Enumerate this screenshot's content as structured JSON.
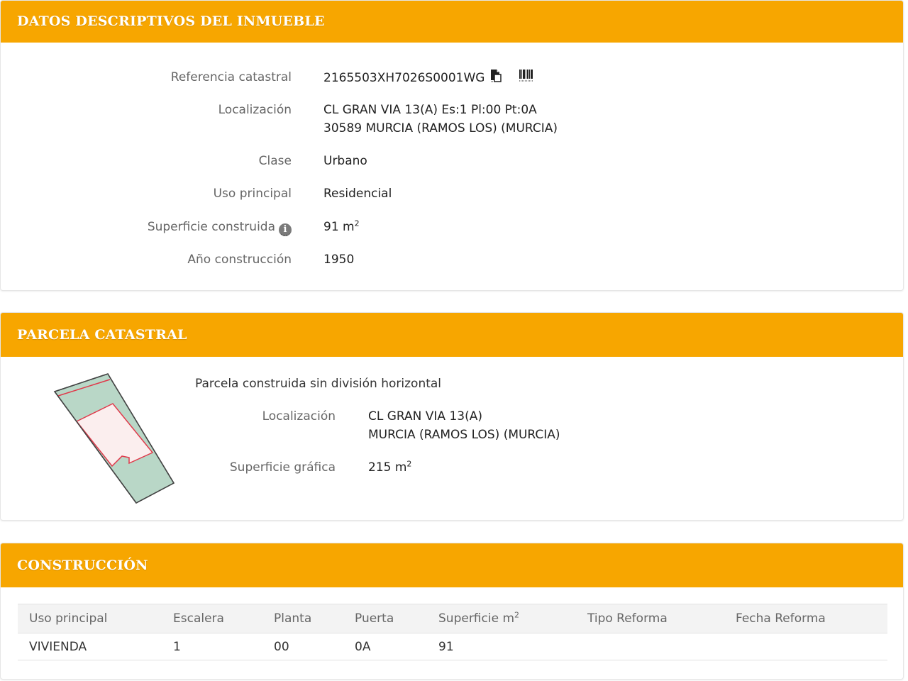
{
  "datos": {
    "title": "DATOS DESCRIPTIVOS DEL INMUEBLE",
    "referencia_label": "Referencia catastral",
    "referencia_value": "2165503XH7026S0001WG",
    "localizacion_label": "Localización",
    "localizacion_line1": "CL GRAN VIA 13(A) Es:1 Pl:00 Pt:0A",
    "localizacion_line2": "30589 MURCIA (RAMOS LOS) (MURCIA)",
    "clase_label": "Clase",
    "clase_value": "Urbano",
    "uso_label": "Uso principal",
    "uso_value": "Residencial",
    "superficie_label": "Superficie construida",
    "superficie_value": "91 m",
    "superficie_exp": "2",
    "anio_label": "Año construcción",
    "anio_value": "1950"
  },
  "parcela": {
    "title": "PARCELA CATASTRAL",
    "subtitle": "Parcela construida sin división horizontal",
    "localizacion_label": "Localización",
    "localizacion_line1": "CL GRAN VIA 13(A)",
    "localizacion_line2": "MURCIA (RAMOS LOS) (MURCIA)",
    "superficie_label": "Superficie gráfica",
    "superficie_value": "215 m",
    "superficie_exp": "2"
  },
  "construccion": {
    "title": "CONSTRUCCIÓN",
    "headers": [
      "Uso principal",
      "Escalera",
      "Planta",
      "Puerta",
      "Superficie m",
      "Tipo Reforma",
      "Fecha Reforma"
    ],
    "superficie_exp": "2",
    "rows": [
      [
        "VIVIENDA",
        "1",
        "00",
        "0A",
        "91",
        "",
        ""
      ]
    ]
  },
  "colors": {
    "header_orange": "#f7a600",
    "parcel_green": "#b9d7c7",
    "parcel_pink": "#fbeeee",
    "parcel_red_line": "#e0394a"
  },
  "icons": [
    "copy-document-icon",
    "barcode-icon",
    "info-icon"
  ]
}
